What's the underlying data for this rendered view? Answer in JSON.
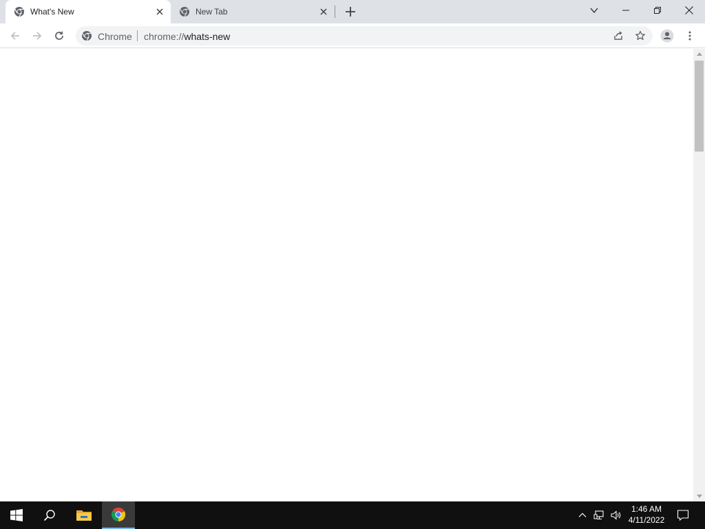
{
  "browser": {
    "tabs": [
      {
        "title": "What's New",
        "active": true,
        "icon": "chrome-icon"
      },
      {
        "title": "New Tab",
        "active": false,
        "icon": "chrome-icon"
      }
    ],
    "omnibox": {
      "site_label": "Chrome",
      "url_scheme": "chrome://",
      "url_path": "whats-new"
    }
  },
  "taskbar": {
    "apps": [
      "start-icon",
      "search-icon",
      "file-explorer-icon",
      "chrome-icon"
    ],
    "clock": {
      "time": "1:46 AM",
      "date": "4/11/2022"
    }
  },
  "colors": {
    "tabstrip_bg": "#dee1e6",
    "omnibox_bg": "#f1f3f4",
    "taskbar_bg": "#101010",
    "taskbar_active_underline": "#76b9ed"
  }
}
